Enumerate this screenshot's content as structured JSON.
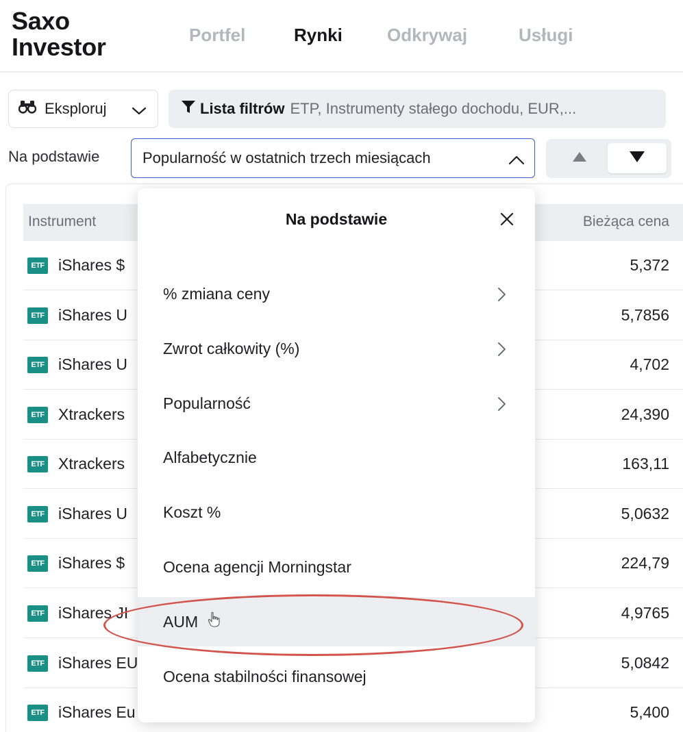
{
  "app": {
    "logo_line1": "Saxo",
    "logo_line2": "Investor"
  },
  "nav": [
    {
      "label": "Portfel",
      "active": false
    },
    {
      "label": "Rynki",
      "active": true
    },
    {
      "label": "Odkrywaj",
      "active": false
    },
    {
      "label": "Usługi",
      "active": false
    }
  ],
  "toolbar": {
    "explore_label": "Eksploruj",
    "filter_title": "Lista filtrów",
    "filter_values": "ETP, Instrumenty stałego dochodu, EUR,...",
    "sort_label": "Na podstawie",
    "sort_value": "Popularność w ostatnich trzech miesiącach"
  },
  "table": {
    "columns": [
      "Instrument",
      "Bieżąca cena"
    ],
    "etf_badge": "ETF",
    "rows": [
      {
        "name": "iShares $",
        "price": "5,372"
      },
      {
        "name": "iShares U",
        "price": "5,7856"
      },
      {
        "name": "iShares U",
        "price": "4,702"
      },
      {
        "name": "Xtrackers",
        "price": "24,390"
      },
      {
        "name": "Xtrackers",
        "price": "163,11"
      },
      {
        "name": "iShares U",
        "price": "5,0632"
      },
      {
        "name": "iShares $",
        "price": "224,79"
      },
      {
        "name": "iShares JI",
        "price": "4,9765"
      },
      {
        "name": "iShares EU",
        "price": "5,0842"
      },
      {
        "name": "iShares Eu",
        "price": "5,400"
      }
    ]
  },
  "dropdown": {
    "title": "Na podstawie",
    "items": [
      {
        "label": "% zmiana ceny",
        "has_submenu": true
      },
      {
        "label": "Zwrot całkowity (%)",
        "has_submenu": true
      },
      {
        "label": "Popularność",
        "has_submenu": true
      },
      {
        "label": "Alfabetycznie",
        "has_submenu": false
      },
      {
        "label": "Koszt %",
        "has_submenu": false
      },
      {
        "label": "Ocena agencji Morningstar",
        "has_submenu": false
      },
      {
        "label": "AUM",
        "has_submenu": false,
        "hovered": true
      },
      {
        "label": "Ocena stabilności finansowej",
        "has_submenu": false
      }
    ]
  },
  "colors": {
    "accent_border": "#3b5bd9",
    "etf_badge": "#1a8f86",
    "annotation": "#d2544c",
    "hover_bg": "#eceef1"
  }
}
